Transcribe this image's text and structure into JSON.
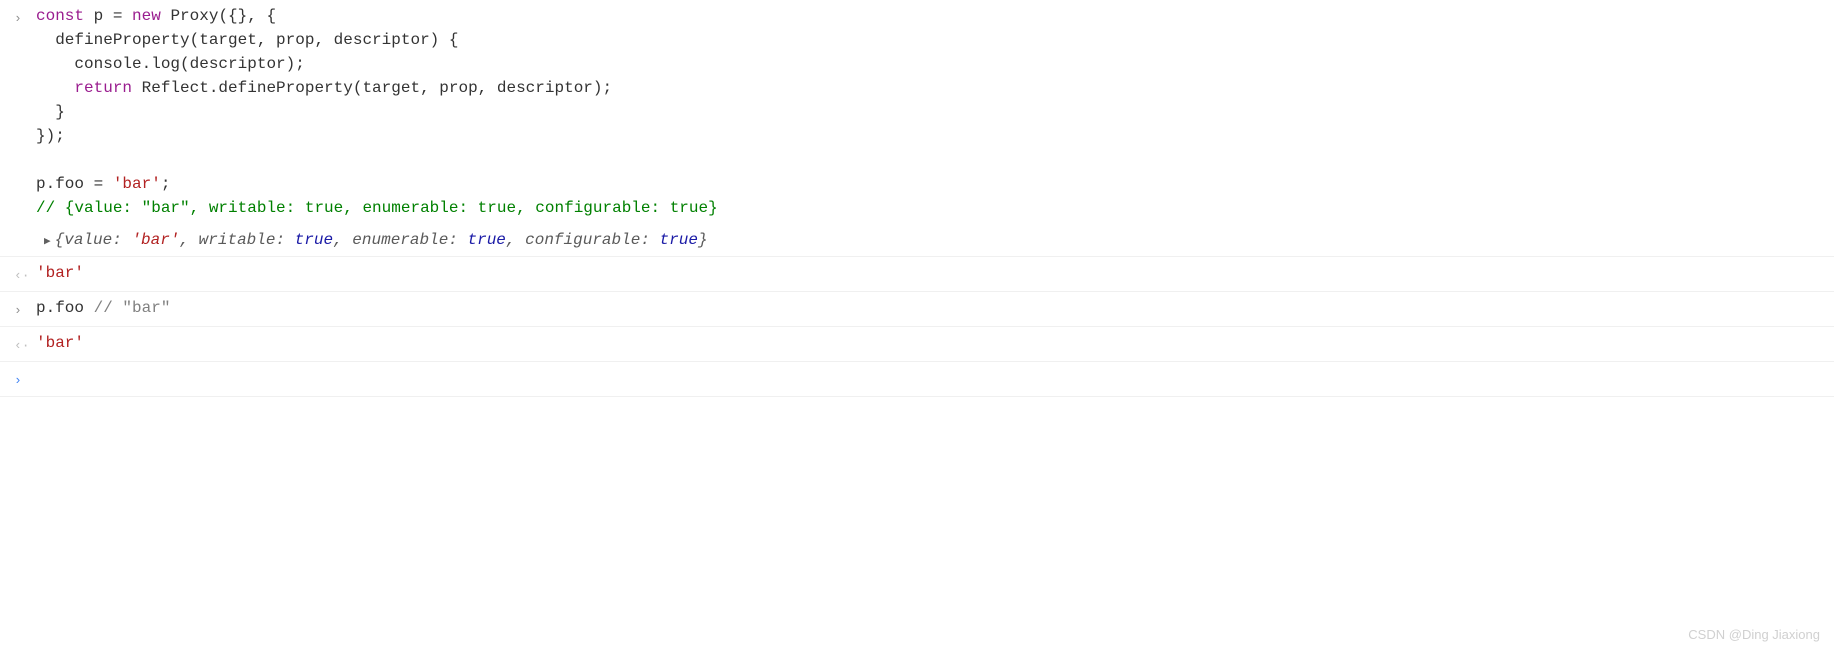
{
  "rows": [
    {
      "type": "input",
      "segments": [
        {
          "cls": "kw-decl",
          "t": "const"
        },
        {
          "cls": "",
          "t": " p = "
        },
        {
          "cls": "kw-new",
          "t": "new"
        },
        {
          "cls": "",
          "t": " Proxy({}, {\n  defineProperty(target, prop, descriptor) {\n    console.log(descriptor);\n    "
        },
        {
          "cls": "kw-return",
          "t": "return"
        },
        {
          "cls": "",
          "t": " Reflect.defineProperty(target, prop, descriptor);\n  }\n});\n\np.foo = "
        },
        {
          "cls": "str",
          "t": "'bar'"
        },
        {
          "cls": "",
          "t": ";\n"
        },
        {
          "cls": "comment-green",
          "t": "// {value: \"bar\", writable: true, enumerable: true, configurable: true}"
        }
      ]
    },
    {
      "type": "log",
      "expand": true,
      "segments": [
        {
          "cls": "log-italic",
          "t": "{value: "
        },
        {
          "cls": "log-str",
          "t": "'bar'"
        },
        {
          "cls": "log-italic",
          "t": ", writable: "
        },
        {
          "cls": "log-bool",
          "t": "true"
        },
        {
          "cls": "log-italic",
          "t": ", enumerable: "
        },
        {
          "cls": "log-bool",
          "t": "true"
        },
        {
          "cls": "log-italic",
          "t": ", configurable: "
        },
        {
          "cls": "log-bool",
          "t": "true"
        },
        {
          "cls": "log-italic",
          "t": "}"
        }
      ]
    },
    {
      "type": "return",
      "segments": [
        {
          "cls": "str",
          "t": "'bar'"
        }
      ]
    },
    {
      "type": "input",
      "segments": [
        {
          "cls": "",
          "t": "p.foo "
        },
        {
          "cls": "comment",
          "t": "// \"bar\""
        }
      ]
    },
    {
      "type": "return",
      "segments": [
        {
          "cls": "str",
          "t": "'bar'"
        }
      ]
    },
    {
      "type": "prompt",
      "segments": []
    }
  ],
  "watermark": "CSDN @Ding Jiaxiong"
}
